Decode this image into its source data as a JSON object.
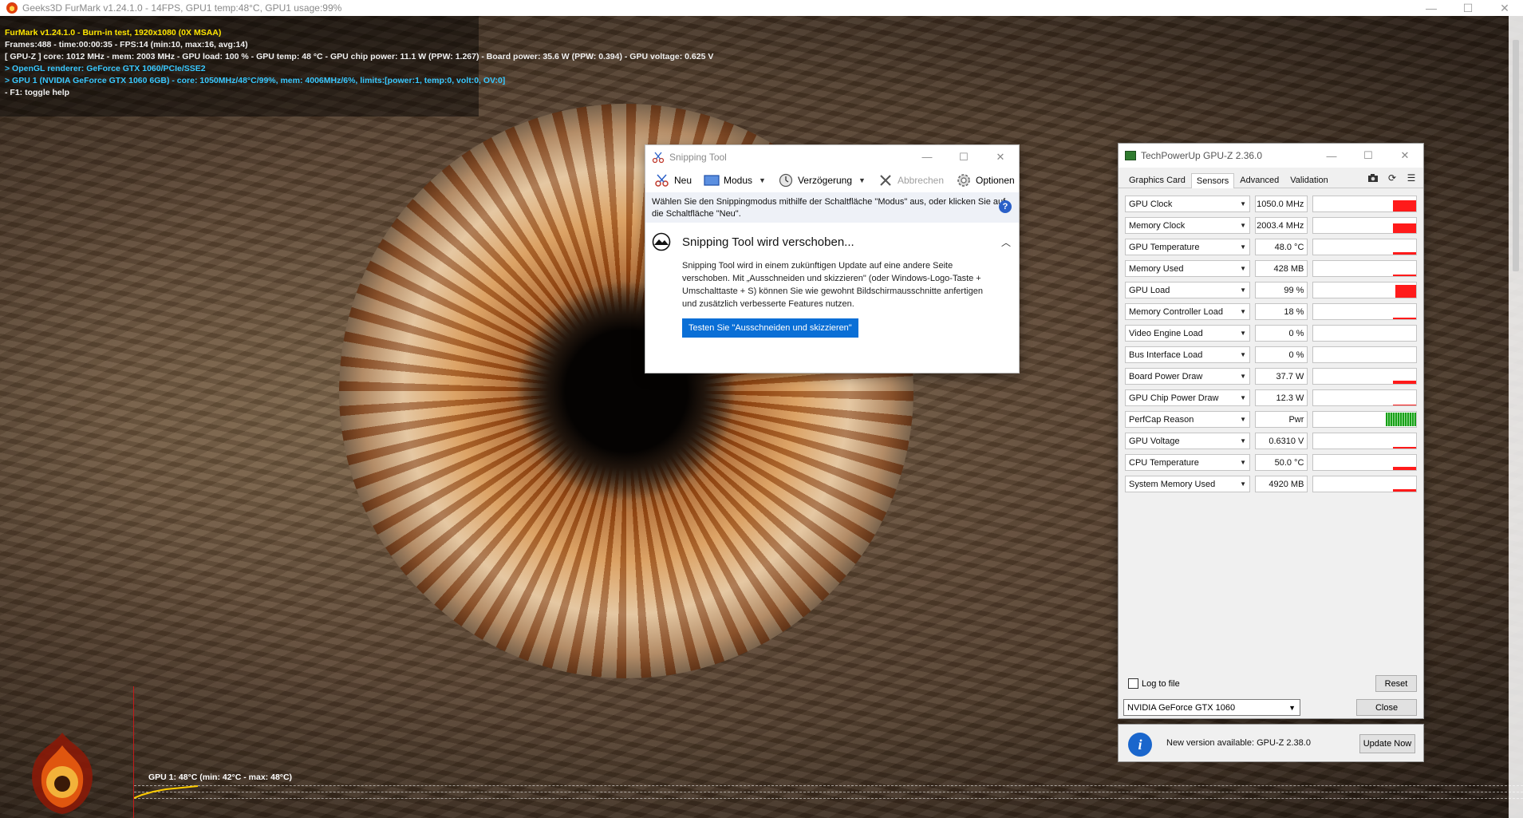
{
  "furmark": {
    "window_title": "Geeks3D FurMark v1.24.1.0 - 14FPS, GPU1 temp:48°C, GPU1 usage:99%",
    "window_controls": {
      "minimize": "—",
      "maximize": "☐",
      "close": "✕"
    },
    "overlay": {
      "line1": "FurMark v1.24.1.0 - Burn-in test, 1920x1080 (0X MSAA)",
      "line2": "Frames:488 - time:00:00:35 - FPS:14 (min:10, max:16, avg:14)",
      "line3": "[ GPU-Z ] core: 1012 MHz - mem: 2003 MHz - GPU load: 100 % - GPU temp: 48 °C - GPU chip power: 11.1 W (PPW: 1.267) - Board power: 35.6 W (PPW: 0.394) - GPU voltage: 0.625 V",
      "line4": "> OpenGL renderer: GeForce GTX 1060/PCIe/SSE2",
      "line5": "> GPU 1 (NVIDIA GeForce GTX 1060 6GB) - core: 1050MHz/48°C/99%, mem: 4006MHz/6%, limits:[power:1, temp:0, volt:0, OV:0]",
      "line6": "- F1: toggle help"
    },
    "graph_label": "GPU 1: 48°C (min: 42°C - max: 48°C)",
    "colors": {
      "yellow": "#ffe600",
      "cyan": "#38c8ff",
      "graph_axis": "#c41a1a",
      "graph_line": "#ffcc00"
    }
  },
  "snipping_tool": {
    "title": "Snipping Tool",
    "toolbar": {
      "new_label": "Neu",
      "mode_label": "Modus",
      "delay_label": "Verzögerung",
      "cancel_label": "Abbrechen",
      "options_label": "Optionen"
    },
    "info_text": "Wählen Sie den Snippingmodus mithilfe der Schaltfläche \"Modus\" aus, oder klicken Sie auf die Schaltfläche \"Neu\".",
    "help_icon": "?",
    "notice": {
      "title": "Snipping Tool wird verschoben...",
      "body": "Snipping Tool wird in einem zukünftigen Update auf eine andere Seite verschoben. Mit „Ausschneiden und skizzieren\" (oder Windows-Logo-Taste + Umschalttaste + S) können Sie wie gewohnt Bildschirmausschnitte anfertigen und zusätzlich verbesserte Features nutzen.",
      "button": "Testen Sie \"Ausschneiden und skizzieren\""
    },
    "colors": {
      "accent": "#0a6fd6",
      "info_bg": "#eef1f7"
    }
  },
  "gpuz": {
    "title": "TechPowerUp GPU-Z 2.36.0",
    "tabs": [
      "Graphics Card",
      "Sensors",
      "Advanced",
      "Validation"
    ],
    "active_tab": "Sensors",
    "sensors": [
      {
        "name": "GPU Clock",
        "value": "1050.0 MHz",
        "level": 0.75,
        "width": 0.22
      },
      {
        "name": "Memory Clock",
        "value": "2003.4 MHz",
        "level": 0.65,
        "width": 0.22
      },
      {
        "name": "GPU Temperature",
        "value": "48.0 °C",
        "level": 0.18,
        "width": 0.22
      },
      {
        "name": "Memory Used",
        "value": "428 MB",
        "level": 0.08,
        "width": 0.22
      },
      {
        "name": "GPU Load",
        "value": "99 %",
        "level": 0.85,
        "width": 0.2
      },
      {
        "name": "Memory Controller Load",
        "value": "18 %",
        "level": 0.1,
        "width": 0.22
      },
      {
        "name": "Video Engine Load",
        "value": "0 %",
        "level": 0,
        "width": 0
      },
      {
        "name": "Bus Interface Load",
        "value": "0 %",
        "level": 0,
        "width": 0
      },
      {
        "name": "Board Power Draw",
        "value": "37.7 W",
        "level": 0.22,
        "width": 0.22
      },
      {
        "name": "GPU Chip Power Draw",
        "value": "12.3 W",
        "level": 0.06,
        "width": 0.22
      },
      {
        "name": "PerfCap Reason",
        "value": "Pwr",
        "level": 1,
        "width": 0.28,
        "perfcap": true
      },
      {
        "name": "GPU Voltage",
        "value": "0.6310 V",
        "level": 0.12,
        "width": 0.22
      },
      {
        "name": "CPU Temperature",
        "value": "50.0 °C",
        "level": 0.22,
        "width": 0.22
      },
      {
        "name": "System Memory Used",
        "value": "4920 MB",
        "level": 0.15,
        "width": 0.22
      }
    ],
    "log_to_file_label": "Log to file",
    "reset_label": "Reset",
    "gpu_select_value": "NVIDIA GeForce GTX 1060",
    "close_label": "Close",
    "update": {
      "message": "New version available: GPU-Z 2.38.0",
      "button": "Update Now"
    },
    "colors": {
      "graph_bar": "#ff1a1a",
      "perfcap_green": "#18a018",
      "info_blue": "#1a66cc"
    }
  }
}
